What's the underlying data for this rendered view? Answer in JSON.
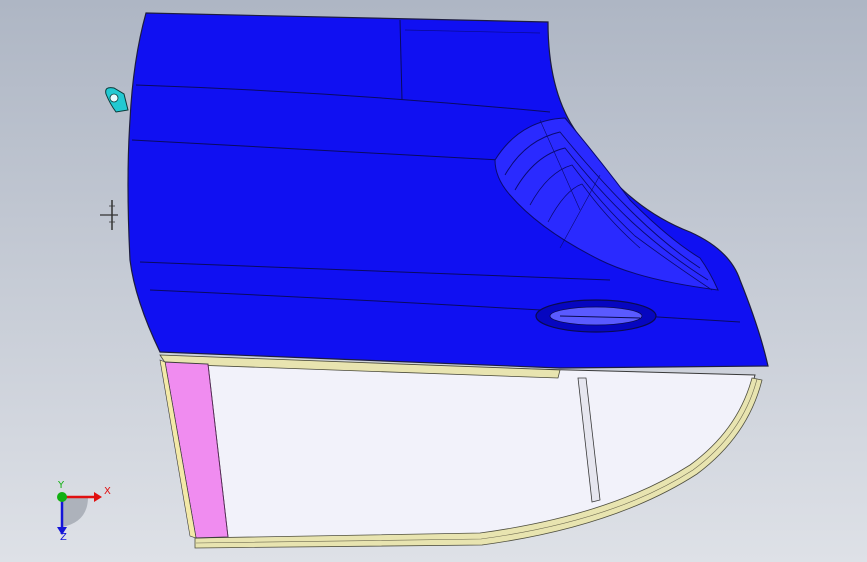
{
  "viewport": {
    "background_top": "#aeb6c4",
    "background_bottom": "#dee1e7"
  },
  "model": {
    "outer_panel_color": "#1010f2",
    "outer_panel_highlight": "#3a3aff",
    "inner_panel_color": "#f2f2fa",
    "hinge_pillar_color": "#f08cf0",
    "seal_strip_color": "#e8e4b0",
    "mount_bracket_color": "#22c9d2"
  },
  "triad": {
    "x_label": "X",
    "y_label": "Y",
    "z_label": "Z",
    "x_color": "#e01010",
    "y_color": "#12b012",
    "z_color": "#1414d8"
  }
}
